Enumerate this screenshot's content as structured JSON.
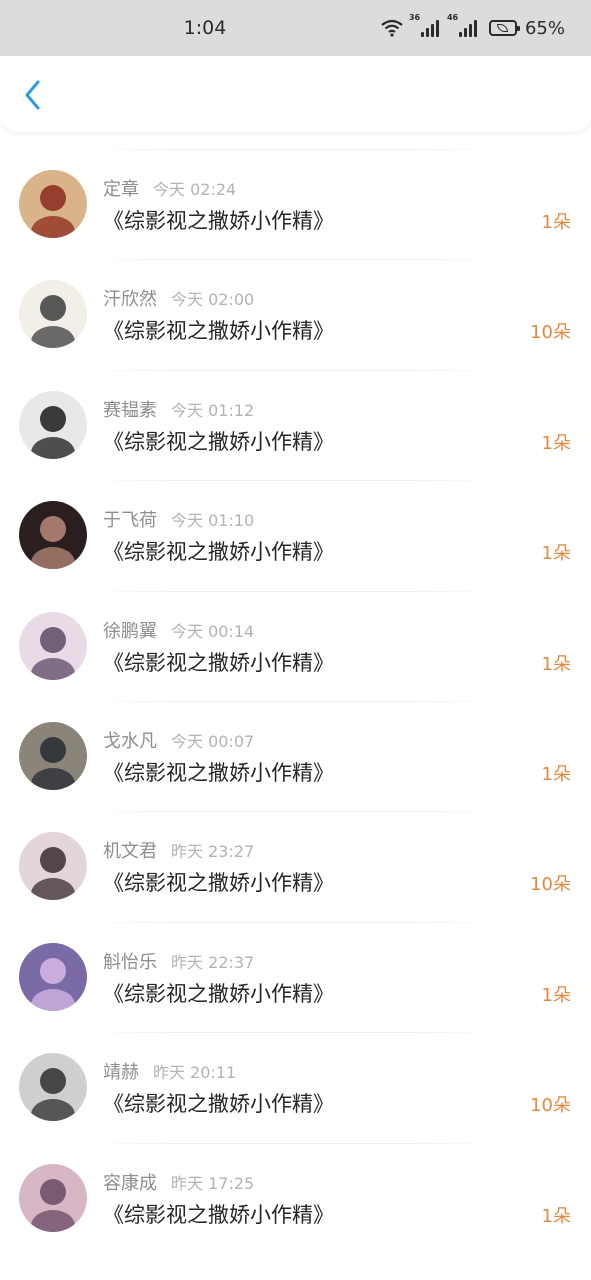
{
  "status_bar": {
    "time": "1:04",
    "net1": "36",
    "net2": "46",
    "battery": "65%"
  },
  "nav": {
    "back_icon": "chevron-left-icon",
    "accent": "#2b9be0"
  },
  "colors": {
    "count": "#e5893e",
    "name": "#8e8e8e",
    "time": "#b3b3b3"
  },
  "gifts": [
    {
      "name": "定章",
      "time": "今天 02:24",
      "book": "《综影视之撒娇小作精》",
      "count": "1朵"
    },
    {
      "name": "汗欣然",
      "time": "今天 02:00",
      "book": "《综影视之撒娇小作精》",
      "count": "10朵"
    },
    {
      "name": "赛韫素",
      "time": "今天 01:12",
      "book": "《综影视之撒娇小作精》",
      "count": "1朵"
    },
    {
      "name": "于飞荷",
      "time": "今天 01:10",
      "book": "《综影视之撒娇小作精》",
      "count": "1朵"
    },
    {
      "name": "徐鹏翼",
      "time": "今天 00:14",
      "book": "《综影视之撒娇小作精》",
      "count": "1朵"
    },
    {
      "name": "戈水凡",
      "time": "今天 00:07",
      "book": "《综影视之撒娇小作精》",
      "count": "1朵"
    },
    {
      "name": "机文君",
      "time": "昨天 23:27",
      "book": "《综影视之撒娇小作精》",
      "count": "10朵"
    },
    {
      "name": "斛怡乐",
      "time": "昨天 22:37",
      "book": "《综影视之撒娇小作精》",
      "count": "1朵"
    },
    {
      "name": "靖赫",
      "time": "昨天 20:11",
      "book": "《综影视之撒娇小作精》",
      "count": "10朵"
    },
    {
      "name": "容康成",
      "time": "昨天 17:25",
      "book": "《综影视之撒娇小作精》",
      "count": "1朵"
    }
  ]
}
